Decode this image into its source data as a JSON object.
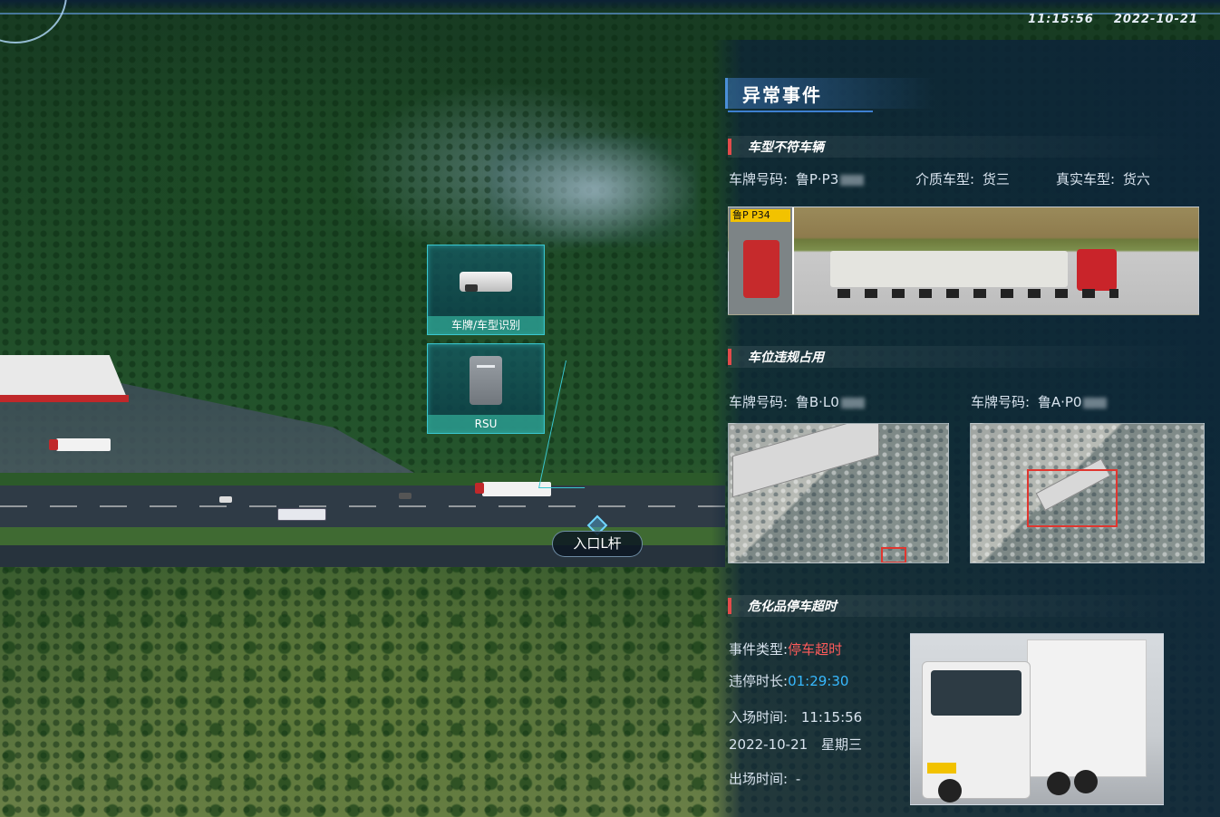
{
  "header": {
    "time": "11:15:56",
    "date": "2022-10-21"
  },
  "map": {
    "devices": [
      {
        "label": "车牌/车型识别",
        "icon": "camera-icon"
      },
      {
        "label": "RSU",
        "icon": "rsu-device-icon"
      }
    ],
    "location_label": "入口L杆"
  },
  "panel": {
    "title": "异常事件",
    "section1": {
      "title": "车型不符车辆",
      "plate_label": "车牌号码:",
      "plate_value": "鲁P·P3",
      "medium_label": "介质车型:",
      "medium_value": "货三",
      "real_label": "真实车型:",
      "real_value": "货六",
      "photo_plate_text": "鲁P P34"
    },
    "section2": {
      "title": "车位违规占用",
      "left_plate_label": "车牌号码:",
      "left_plate_value": "鲁B·L0",
      "right_plate_label": "车牌号码:",
      "right_plate_value": "鲁A·P0"
    },
    "section3": {
      "title": "危化品停车超时",
      "event_type_label": "事件类型:",
      "event_type_value": "停车超时",
      "duration_label": "违停时长:",
      "duration_value": "01:29:30",
      "entry_label": "入场时间:",
      "entry_time": "11:15:56",
      "entry_date": "2022-10-21",
      "entry_weekday": "星期三",
      "exit_label": "出场时间:",
      "exit_value": "-"
    },
    "colors": {
      "alert": "#ff5b5b",
      "highlight": "#37b9ff",
      "section_bar": "#e34b4b"
    }
  }
}
